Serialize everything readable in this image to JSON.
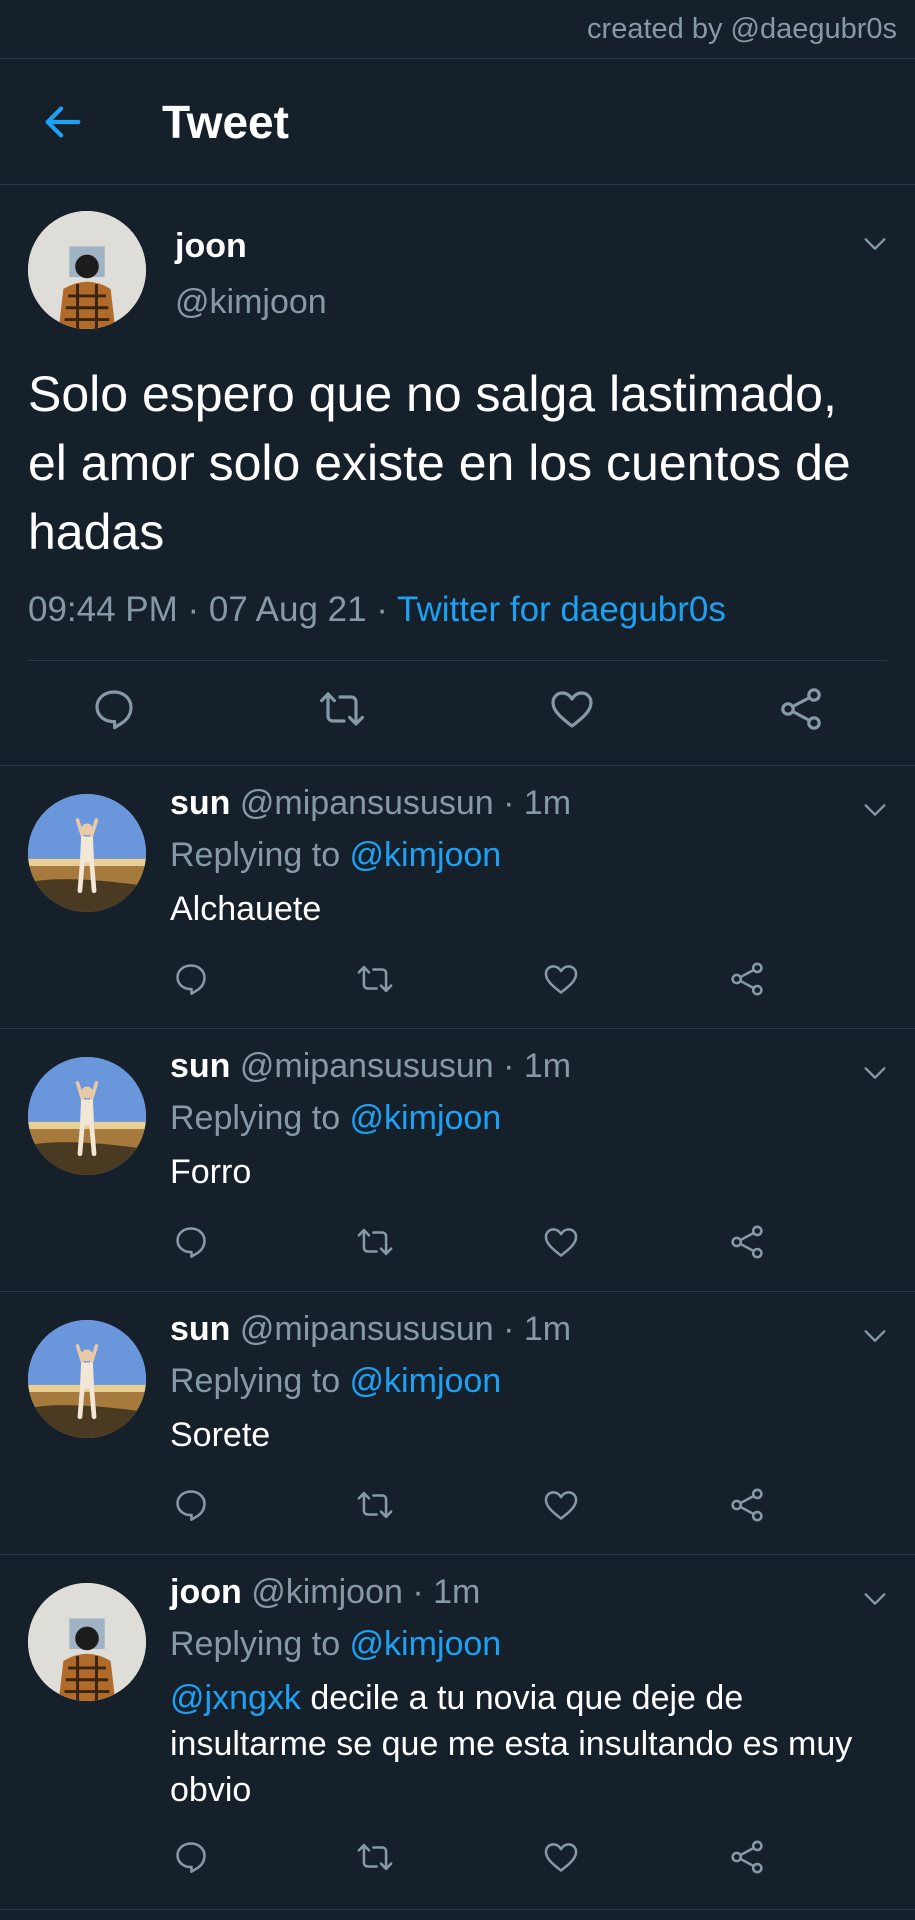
{
  "credit": "created by @daegubr0s",
  "header": {
    "title": "Tweet"
  },
  "main_tweet": {
    "name": "joon",
    "handle": "@kimjoon",
    "text": "Solo espero que no salga lastimado, el amor solo existe en los cuentos de hadas",
    "time": "09:44 PM · 07 Aug 21 · ",
    "source": "Twitter for daegubr0s"
  },
  "replies": [
    {
      "name": "sun",
      "meta": " @mipansususun · 1m",
      "replying_label": "Replying to ",
      "replying_to": "@kimjoon",
      "text": "Alchauete"
    },
    {
      "name": "sun",
      "meta": " @mipansususun · 1m",
      "replying_label": "Replying to ",
      "replying_to": "@kimjoon",
      "text": "Forro"
    },
    {
      "name": "sun",
      "meta": " @mipansususun · 1m",
      "replying_label": "Replying to ",
      "replying_to": "@kimjoon",
      "text": "Sorete"
    },
    {
      "name": "joon",
      "meta": " @kimjoon · 1m",
      "replying_label": "Replying to ",
      "replying_to": "@kimjoon",
      "mention": "@jxngxk",
      "text": " decile a tu novia que deje de insultarme se que me esta insultando es muy obvio"
    }
  ],
  "colors": {
    "background": "#15202b",
    "accent": "#1da1f2",
    "muted": "#8899a6"
  },
  "icons": [
    "back-arrow-icon",
    "chevron-down-icon",
    "reply-icon",
    "retweet-icon",
    "like-icon",
    "share-icon"
  ]
}
